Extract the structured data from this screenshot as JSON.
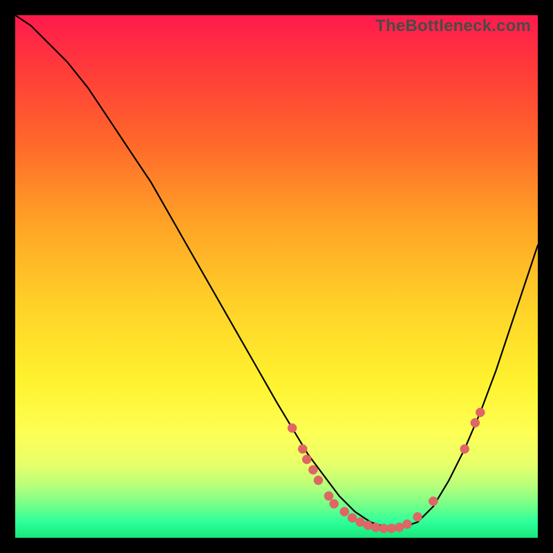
{
  "watermark": "TheBottleneck.com",
  "colors": {
    "dot_fill": "#e06666",
    "curve_stroke": "#000000"
  },
  "chart_data": {
    "type": "line",
    "title": "",
    "xlabel": "",
    "ylabel": "",
    "xlim": [
      0,
      100
    ],
    "ylim": [
      0,
      100
    ],
    "x": [
      0,
      3,
      6,
      10,
      14,
      18,
      22,
      26,
      30,
      34,
      38,
      42,
      46,
      50,
      53,
      56,
      59,
      62,
      65,
      68,
      71,
      74,
      77,
      80,
      83,
      86,
      89,
      92,
      95,
      98,
      100
    ],
    "values": [
      100,
      98,
      95,
      91,
      86,
      80,
      74,
      68,
      61,
      54,
      47,
      40,
      33,
      26,
      21,
      16,
      12,
      8,
      5,
      3,
      2,
      2,
      3,
      6,
      11,
      17,
      24,
      32,
      41,
      50,
      56
    ],
    "dots": [
      {
        "x": 53,
        "y": 21
      },
      {
        "x": 55,
        "y": 17
      },
      {
        "x": 55.8,
        "y": 15
      },
      {
        "x": 57,
        "y": 13
      },
      {
        "x": 58,
        "y": 11
      },
      {
        "x": 60,
        "y": 8
      },
      {
        "x": 61,
        "y": 6.5
      },
      {
        "x": 63,
        "y": 5
      },
      {
        "x": 64.5,
        "y": 3.8
      },
      {
        "x": 66,
        "y": 3
      },
      {
        "x": 67.5,
        "y": 2.4
      },
      {
        "x": 69,
        "y": 2
      },
      {
        "x": 70.5,
        "y": 1.8
      },
      {
        "x": 72,
        "y": 1.8
      },
      {
        "x": 73.5,
        "y": 2
      },
      {
        "x": 75,
        "y": 2.6
      },
      {
        "x": 77,
        "y": 4
      },
      {
        "x": 80,
        "y": 7
      },
      {
        "x": 86,
        "y": 17
      },
      {
        "x": 88,
        "y": 22
      },
      {
        "x": 89,
        "y": 24
      }
    ]
  }
}
